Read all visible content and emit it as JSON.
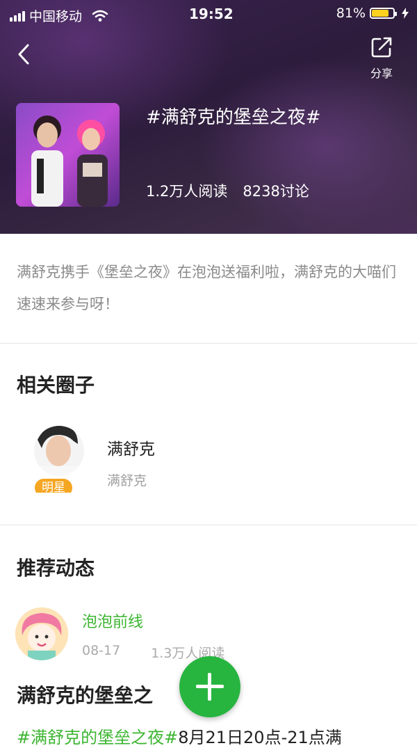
{
  "status_bar": {
    "carrier": "中国移动",
    "time": "19:52",
    "battery_percent": "81%",
    "battery_level": 0.81,
    "battery_color": "#ffd21f"
  },
  "header": {
    "back_icon": "chevron-left-icon",
    "share_label": "分享",
    "share_icon": "share-icon",
    "topic_title": "#满舒克的堡垒之夜#",
    "reads": "1.2万人阅读",
    "discussions": "8238讨论"
  },
  "description": "满舒克携手《堡垒之夜》在泡泡送福利啦，满舒克的大喵们速速来参与呀！",
  "related_circles": {
    "section_title": "相关圈子",
    "items": [
      {
        "name": "满舒克",
        "subtitle": "满舒克",
        "badge": "明星"
      }
    ]
  },
  "feed": {
    "section_title": "推荐动态",
    "post": {
      "author": "泡泡前线",
      "date": "08-17",
      "reads": "1.3万人阅读",
      "title": "满舒克的堡垒之",
      "tag": "#满舒克的堡垒之夜#",
      "snippet": "8月21日20点-21点满"
    }
  },
  "fab": {
    "icon": "plus-icon"
  },
  "colors": {
    "accent_green": "#3cb531",
    "fab_green": "#27b53f",
    "badge_orange": "#f5a623"
  }
}
